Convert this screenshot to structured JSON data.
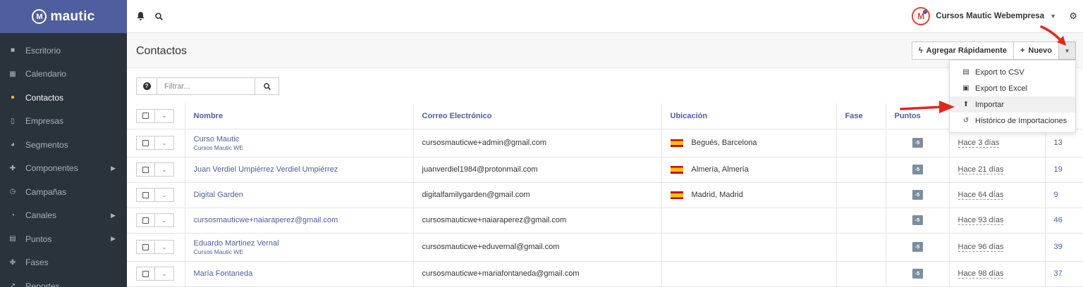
{
  "brand": {
    "name": "mautic",
    "logo_letter": "M"
  },
  "sidebar": {
    "items": [
      {
        "label": "Escritorio",
        "icon": "th-large-icon",
        "glyph": "■",
        "active": false,
        "submenu": false
      },
      {
        "label": "Calendario",
        "icon": "calendar-icon",
        "glyph": "▦",
        "active": false,
        "submenu": false
      },
      {
        "label": "Contactos",
        "icon": "user-icon",
        "glyph": "●",
        "active": true,
        "submenu": false
      },
      {
        "label": "Empresas",
        "icon": "building-icon",
        "glyph": "▯",
        "active": false,
        "submenu": false
      },
      {
        "label": "Segmentos",
        "icon": "pie-chart-icon",
        "glyph": "◕",
        "active": false,
        "submenu": false
      },
      {
        "label": "Componentes",
        "icon": "puzzle-icon",
        "glyph": "✚",
        "active": false,
        "submenu": true
      },
      {
        "label": "Campañas",
        "icon": "clock-icon",
        "glyph": "◷",
        "active": false,
        "submenu": false
      },
      {
        "label": "Canales",
        "icon": "rss-icon",
        "glyph": "◔",
        "active": false,
        "submenu": true
      },
      {
        "label": "Puntos",
        "icon": "calculator-icon",
        "glyph": "▤",
        "active": false,
        "submenu": true
      },
      {
        "label": "Fases",
        "icon": "flow-icon",
        "glyph": "✤",
        "active": false,
        "submenu": false
      },
      {
        "label": "Reportes",
        "icon": "line-chart-icon",
        "glyph": "↗",
        "active": false,
        "submenu": false
      }
    ]
  },
  "topbar": {
    "account_name": "Cursos Mautic Webempresa",
    "avatar_letter": "M"
  },
  "page": {
    "title": "Contactos",
    "quick_add_label": "Agregar Rápidamente",
    "new_label": "Nuevo"
  },
  "dropdown": {
    "items": [
      {
        "label": "Export to CSV",
        "icon": "file-text-icon",
        "glyph": "▤"
      },
      {
        "label": "Export to Excel",
        "icon": "file-excel-icon",
        "glyph": "▣"
      },
      {
        "label": "Importar",
        "icon": "upload-icon",
        "glyph": "⬆"
      },
      {
        "label": "Histórico de Importaciones",
        "icon": "history-icon",
        "glyph": "↺"
      }
    ]
  },
  "filter": {
    "placeholder": "Filtrar..."
  },
  "table": {
    "headers": [
      "Nombre",
      "Correo Electrónico",
      "Ubicación",
      "Fase",
      "Puntos"
    ],
    "rows": [
      {
        "name": "Curso Mautic",
        "company": "Cursos Mautic WE",
        "email": "cursosmauticwe+admin@gmail.com",
        "location": "Begués, Barcelona",
        "flag": true,
        "stage": "",
        "points": "-5",
        "last_active": "Hace 3 días",
        "id": "13"
      },
      {
        "name": "Juan Verdiel Umpiérrez Verdiel Umpiérrez",
        "company": "",
        "email": "juanverdiel1984@protonmail.com",
        "location": "Almería, Almería",
        "flag": true,
        "stage": "",
        "points": "-5",
        "last_active": "Hace 21 días",
        "id": "19"
      },
      {
        "name": "Digital Garden",
        "company": "",
        "email": "digitalfamilygarden@gmail.com",
        "location": "Madrid, Madrid",
        "flag": true,
        "stage": "",
        "points": "-5",
        "last_active": "Hace 64 días",
        "id": "9"
      },
      {
        "name": "cursosmauticwe+naiaraperez@gmail.com",
        "company": "",
        "email": "cursosmauticwe+naiaraperez@gmail.com",
        "location": "",
        "flag": false,
        "stage": "",
        "points": "-5",
        "last_active": "Hace 93 días",
        "id": "46"
      },
      {
        "name": "Eduardo Martinez Vernal",
        "company": "Cursos Mautic WE",
        "email": "cursosmauticwe+eduvernal@gmail.com",
        "location": "",
        "flag": false,
        "stage": "",
        "points": "-5",
        "last_active": "Hace 96 días",
        "id": "39"
      },
      {
        "name": "María Fontaneda",
        "company": "",
        "email": "cursosmauticwe+mariafontaneda@gmail.com",
        "location": "",
        "flag": false,
        "stage": "",
        "points": "-5",
        "last_active": "Hace 98 días",
        "id": "37"
      }
    ]
  },
  "colors": {
    "accent": "#4e5e9e",
    "sidebar_bg": "#2a323c",
    "active_icon": "#fdb933",
    "arrow": "#e3261e"
  }
}
